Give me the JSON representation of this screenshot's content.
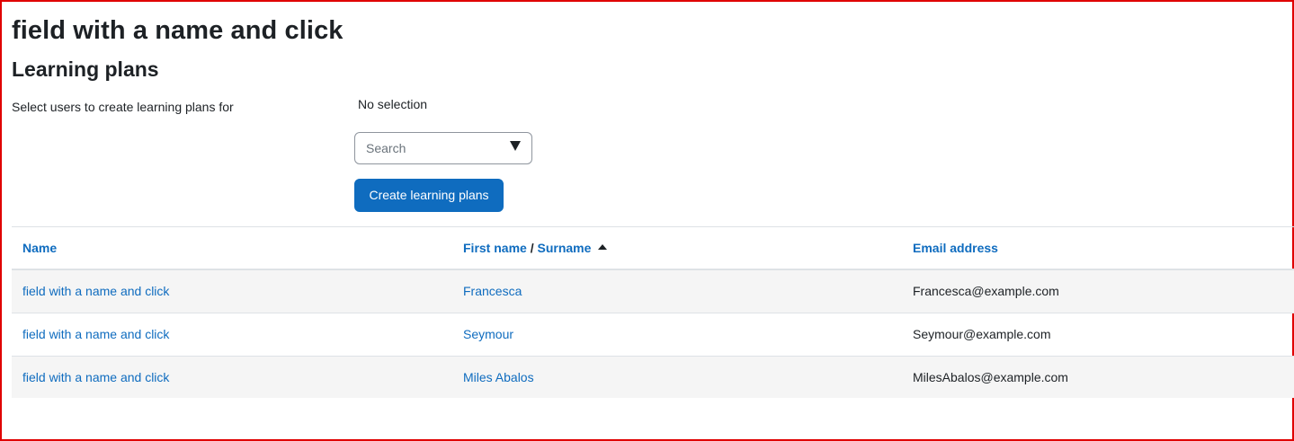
{
  "page": {
    "heading": "field with a name and click",
    "section_heading": "Learning plans"
  },
  "form": {
    "label": "Select users to create learning plans for",
    "selection_status": "No selection",
    "search_placeholder": "Search",
    "create_button_label": "Create learning plans"
  },
  "table": {
    "headers": {
      "name": "Name",
      "first_name": "First name",
      "separator": " / ",
      "surname": "Surname",
      "email": "Email address"
    },
    "sort": {
      "column": "surname",
      "direction": "ascending"
    },
    "rows": [
      {
        "name": "field with a name and click",
        "user": "Francesca",
        "email": "Francesca@example.com"
      },
      {
        "name": "field with a name and click",
        "user": "Seymour",
        "email": "Seymour@example.com"
      },
      {
        "name": "field with a name and click",
        "user": "Miles Abalos",
        "email": "MilesAbalos@example.com"
      }
    ]
  },
  "colors": {
    "link": "#0f6cbf",
    "button_bg": "#0f6cbf",
    "frame_border": "#e00000",
    "stripe": "#f5f5f5"
  },
  "icons": {
    "search_dropdown": "triangle-down-icon",
    "sort_indicator": "sort-ascending-icon"
  }
}
